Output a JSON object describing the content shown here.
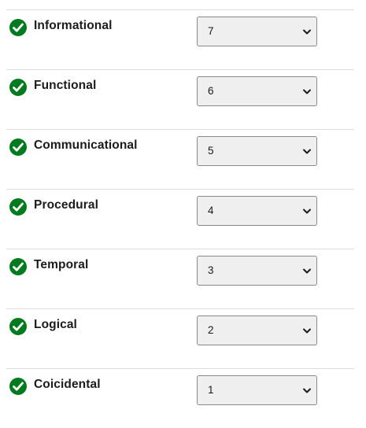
{
  "colors": {
    "check_fill": "#007a1f",
    "select_bg": "#efefef",
    "select_border": "#8a8a8a",
    "divider": "#dddddd",
    "text": "#1b1b1b"
  },
  "rows": [
    {
      "label": "Informational",
      "selected": "7",
      "status_icon": "check-circle-icon"
    },
    {
      "label": "Functional",
      "selected": "6",
      "status_icon": "check-circle-icon"
    },
    {
      "label": "Communicational",
      "selected": "5",
      "status_icon": "check-circle-icon"
    },
    {
      "label": "Procedural",
      "selected": "4",
      "status_icon": "check-circle-icon"
    },
    {
      "label": "Temporal",
      "selected": "3",
      "status_icon": "check-circle-icon"
    },
    {
      "label": "Logical",
      "selected": "2",
      "status_icon": "check-circle-icon"
    },
    {
      "label": "Coicidental",
      "selected": "1",
      "status_icon": "check-circle-icon"
    }
  ]
}
